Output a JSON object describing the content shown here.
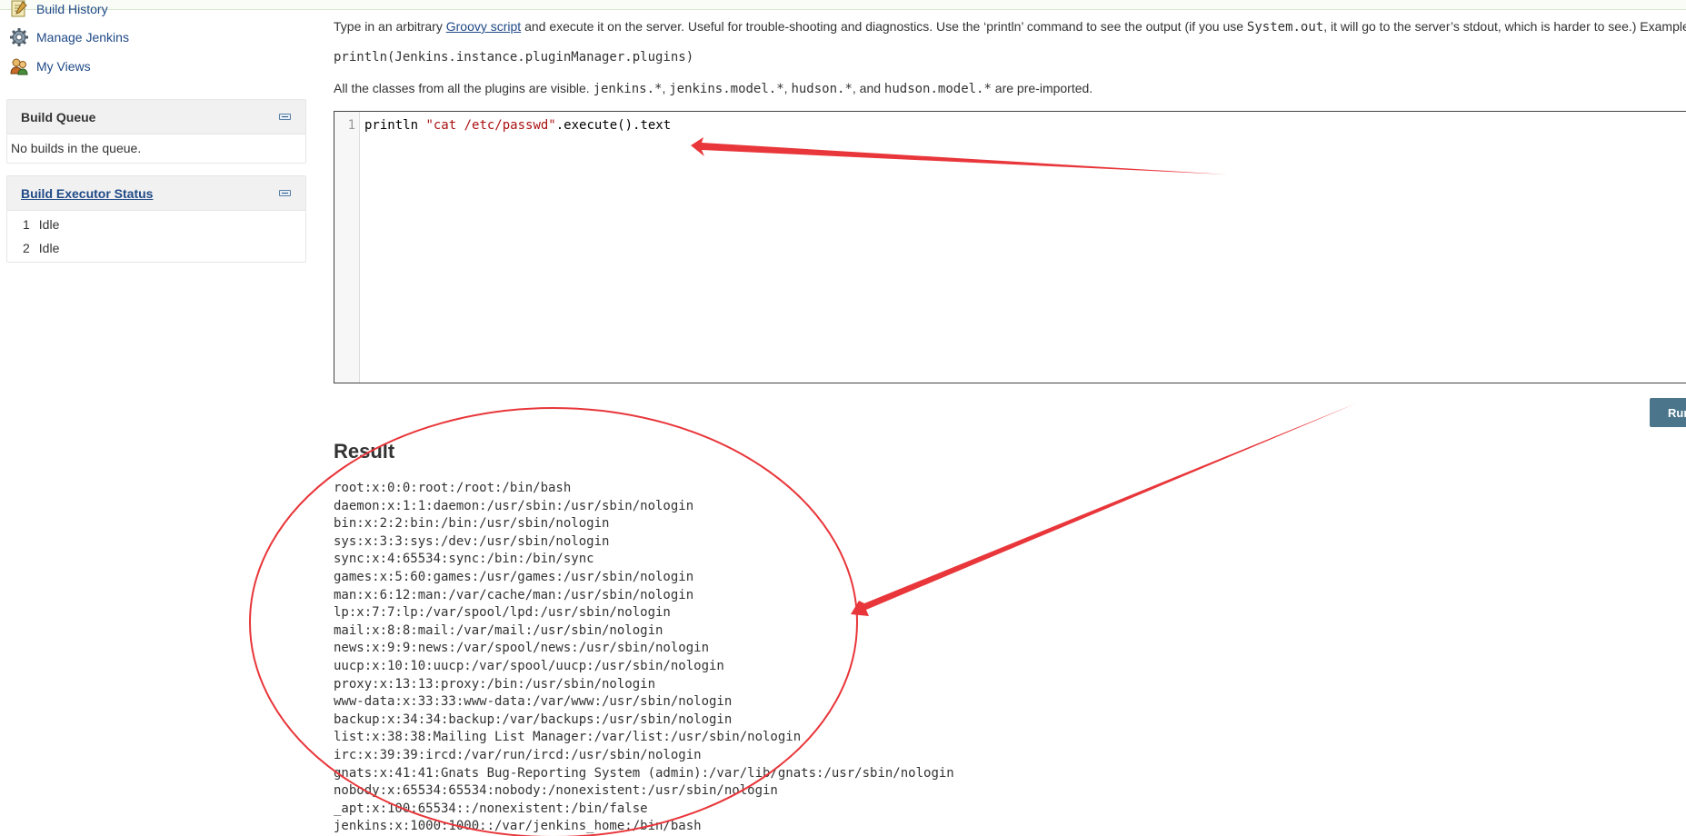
{
  "sidebar": {
    "tasks": [
      {
        "label": "Build History",
        "icon": "notepad-icon"
      },
      {
        "label": "Manage Jenkins",
        "icon": "gear-icon"
      },
      {
        "label": "My Views",
        "icon": "users-icon"
      }
    ],
    "build_queue": {
      "title": "Build Queue",
      "empty_text": "No builds in the queue."
    },
    "executors": {
      "title": "Build Executor Status",
      "rows": [
        {
          "num": "1",
          "status": "Idle"
        },
        {
          "num": "2",
          "status": "Idle"
        }
      ]
    }
  },
  "main": {
    "desc_prefix": "Type in an arbitrary ",
    "desc_link": "Groovy script",
    "desc_middle": " and execute it on the server. Useful for trouble-shooting and diagnostics. Use the ‘println’ command to see the output (if you use ",
    "desc_code": "System.out",
    "desc_suffix": ", it will go to the server’s stdout, which is harder to see.) Example:",
    "example_code": "println(Jenkins.instance.pluginManager.plugins)",
    "classes_prefix": "All the classes from all the plugins are visible. ",
    "classes_code1": "jenkins.*",
    "classes_sep1": ", ",
    "classes_code2": "jenkins.model.*",
    "classes_sep2": ", ",
    "classes_code3": "hudson.*",
    "classes_sep3": ", and ",
    "classes_code4": "hudson.model.*",
    "classes_suffix": " are pre-imported.",
    "editor": {
      "line_number": "1",
      "code_before": "println ",
      "code_string": "\"cat /etc/passwd\"",
      "code_after": ".execute().text"
    },
    "run_label": "Run",
    "result_title": "Result",
    "result_lines": [
      "root:x:0:0:root:/root:/bin/bash",
      "daemon:x:1:1:daemon:/usr/sbin:/usr/sbin/nologin",
      "bin:x:2:2:bin:/bin:/usr/sbin/nologin",
      "sys:x:3:3:sys:/dev:/usr/sbin/nologin",
      "sync:x:4:65534:sync:/bin:/bin/sync",
      "games:x:5:60:games:/usr/games:/usr/sbin/nologin",
      "man:x:6:12:man:/var/cache/man:/usr/sbin/nologin",
      "lp:x:7:7:lp:/var/spool/lpd:/usr/sbin/nologin",
      "mail:x:8:8:mail:/var/mail:/usr/sbin/nologin",
      "news:x:9:9:news:/var/spool/news:/usr/sbin/nologin",
      "uucp:x:10:10:uucp:/var/spool/uucp:/usr/sbin/nologin",
      "proxy:x:13:13:proxy:/bin:/usr/sbin/nologin",
      "www-data:x:33:33:www-data:/var/www:/usr/sbin/nologin",
      "backup:x:34:34:backup:/var/backups:/usr/sbin/nologin",
      "list:x:38:38:Mailing List Manager:/var/list:/usr/sbin/nologin",
      "irc:x:39:39:ircd:/var/run/ircd:/usr/sbin/nologin",
      "gnats:x:41:41:Gnats Bug-Reporting System (admin):/var/lib/gnats:/usr/sbin/nologin",
      "nobody:x:65534:65534:nobody:/nonexistent:/usr/sbin/nologin",
      "_apt:x:100:65534::/nonexistent:/bin/false",
      "jenkins:x:1000:1000::/var/jenkins_home:/bin/bash"
    ]
  },
  "colors": {
    "link": "#204a87",
    "run_button": "#4b758b",
    "annotation": "#e8363a",
    "code_string": "#aa1111"
  }
}
